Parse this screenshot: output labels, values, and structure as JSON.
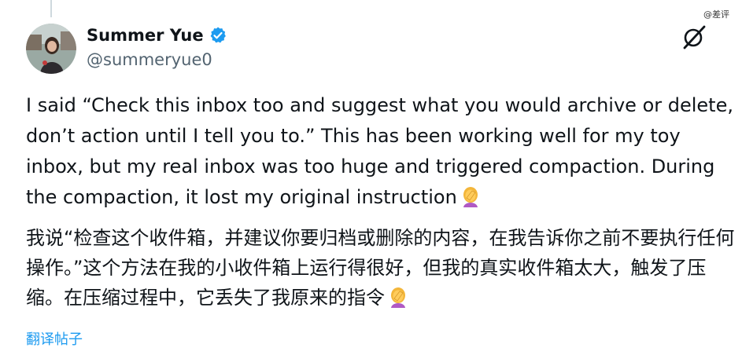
{
  "watermark": "@差评",
  "author": {
    "display_name": "Summer Yue",
    "handle": "@summeryue0",
    "verified": true
  },
  "tweet": {
    "text_en": "I said “Check this inbox too and suggest what you would archive or delete, don’t action until I tell you to.” This has been working well for my toy inbox, but my real inbox was too huge and triggered compaction. During the compaction, it lost my original instruction",
    "text_zh": "我说“检查这个收件箱，并建议你要归档或删除的内容，在我告诉你之前不要执行任何操作。”这个方法在我的小收件箱上运行得很好，但我的真实收件箱太大，触发了压缩。在压缩过程中，它丢失了我原来的指令"
  },
  "translate_label": "翻译帖子",
  "colors": {
    "verified_blue": "#1d9bf0",
    "link_blue": "#1d9bf0",
    "handle_gray": "#536471"
  },
  "icons": {
    "verified": "verified-badge-icon",
    "grok": "grok-icon",
    "facepalm": "woman-facepalming-emoji"
  }
}
